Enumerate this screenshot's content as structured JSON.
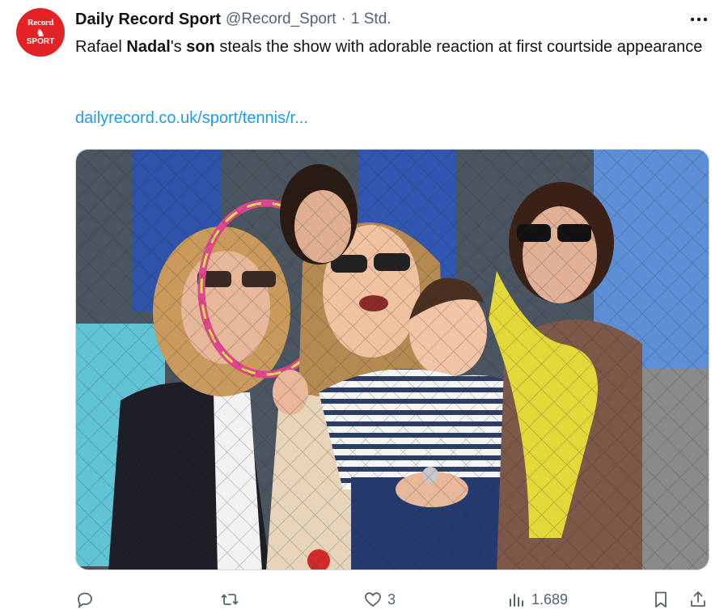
{
  "tweet": {
    "author_name": "Daily Record Sport",
    "handle": "@Record_Sport",
    "separator": "·",
    "time": "1 Std.",
    "avatar_text_top": "Record",
    "avatar_text_bottom": "SPORT",
    "text_parts": [
      "Rafael ",
      "Nadal",
      "'s ",
      "son",
      " steals the show with adorable reaction at first courtside appearance"
    ],
    "link": "dailyrecord.co.uk/sport/tennis/r...",
    "more_label": "•••",
    "image_alt": "Woman holding a baby in a striped jumper at courtside, another woman holding a tennis racket in front of her face"
  },
  "actions": {
    "reply_count": "",
    "retweet_count": "",
    "like_count": "3",
    "views_count": "1.689"
  },
  "colors": {
    "brand_red": "#e32226",
    "link_blue": "#1d9bf0",
    "muted": "#536471"
  }
}
